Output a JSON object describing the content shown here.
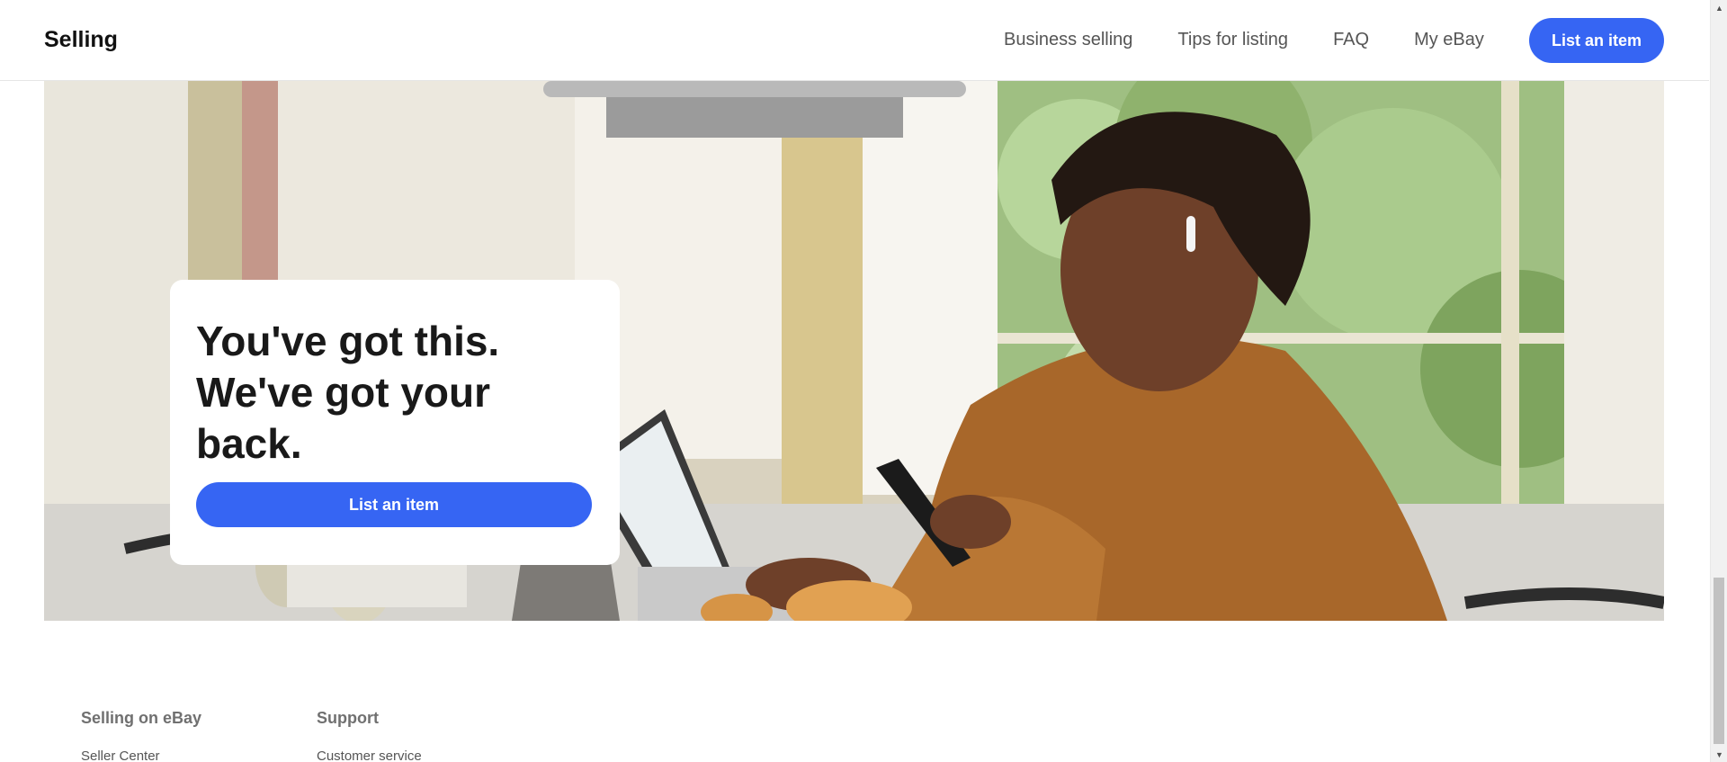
{
  "header": {
    "brand": "Selling",
    "nav": [
      {
        "label": "Business selling"
      },
      {
        "label": "Tips for listing"
      },
      {
        "label": "FAQ"
      },
      {
        "label": "My eBay"
      }
    ],
    "cta_label": "List an item"
  },
  "hero": {
    "headline": "You've got this. We've got your back.",
    "cta_label": "List an item",
    "image_subject": "woman-at-laptop-with-phone"
  },
  "footer": {
    "columns": [
      {
        "heading": "Selling on eBay",
        "links": [
          "Seller Center"
        ]
      },
      {
        "heading": "Support",
        "links": [
          "Customer service"
        ]
      }
    ]
  },
  "colors": {
    "accent": "#3665f3",
    "text": "#191919",
    "muted": "#555555"
  }
}
